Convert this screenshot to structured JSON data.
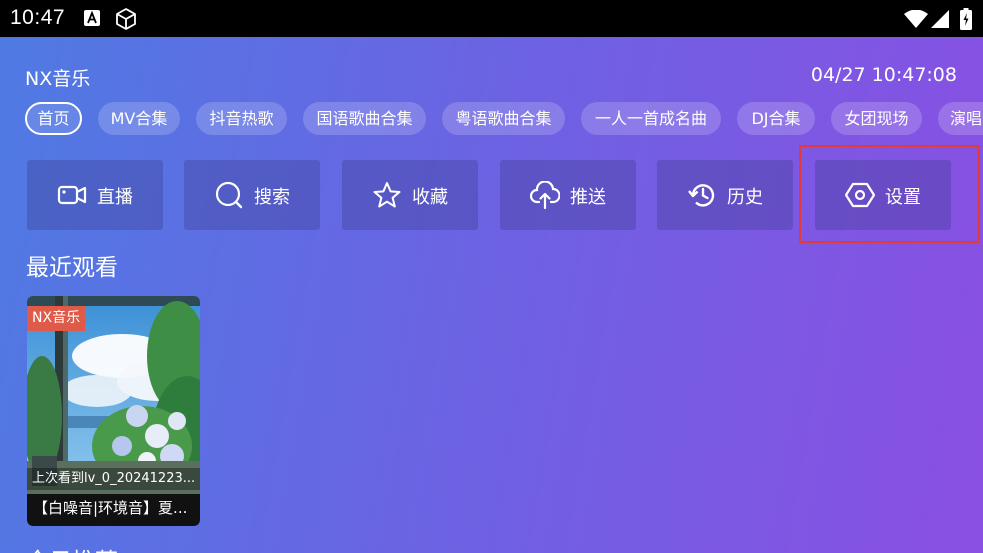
{
  "status_bar": {
    "time": "10:47",
    "icons": [
      "notification-a-icon",
      "cube-icon",
      "wifi-icon",
      "signal-icon",
      "battery-icon"
    ]
  },
  "header": {
    "app_title": "NX音乐",
    "datetime": "04/27 10:47:08"
  },
  "tabs": [
    {
      "label": "首页",
      "active": true
    },
    {
      "label": "MV合集"
    },
    {
      "label": "抖音热歌"
    },
    {
      "label": "国语歌曲合集"
    },
    {
      "label": "粤语歌曲合集"
    },
    {
      "label": "一人一首成名曲"
    },
    {
      "label": "DJ合集"
    },
    {
      "label": "女团现场"
    },
    {
      "label": "演唱"
    }
  ],
  "tiles": [
    {
      "label": "直播",
      "icon": "video-camera-icon"
    },
    {
      "label": "搜索",
      "icon": "search-icon"
    },
    {
      "label": "收藏",
      "icon": "star-icon"
    },
    {
      "label": "推送",
      "icon": "cloud-upload-icon"
    },
    {
      "label": "历史",
      "icon": "history-icon"
    },
    {
      "label": "设置",
      "icon": "hexagon-settings-icon"
    }
  ],
  "recent": {
    "section_title": "最近观看",
    "items": [
      {
        "badge": "NX音乐",
        "progress_text": "上次看到lv_0_20241223...",
        "title": "【白噪音|环境音】夏..."
      }
    ]
  },
  "next_section": {
    "title": "今日推荐"
  },
  "colors": {
    "gradient_start": "#4f7ae3",
    "gradient_end": "#8a4fe3",
    "highlight": "#e53935",
    "badge": "#e05a4a"
  }
}
